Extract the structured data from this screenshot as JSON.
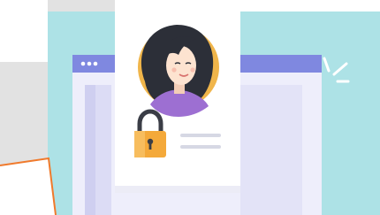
{
  "illustration": {
    "subject": "user-profile-card-with-padlock",
    "icons": [
      "avatar-woman",
      "padlock",
      "browser-window",
      "sparkle"
    ],
    "colors": {
      "teal_background": "#ade2e6",
      "gray_background": "#e2e2e2",
      "card": "#ffffff",
      "window_frame": "#7f88e0",
      "window_inner": "#dcdcf5",
      "window_shadow": "#2f3034",
      "padlock_body": "#f4a93a",
      "padlock_shackle": "#3a3d46",
      "hair": "#2c2f38",
      "skin": "#fde3d0",
      "shirt": "#9d6fd2",
      "avatar_circle": "#f0b54a",
      "callout_border": "#f07a2c"
    }
  }
}
